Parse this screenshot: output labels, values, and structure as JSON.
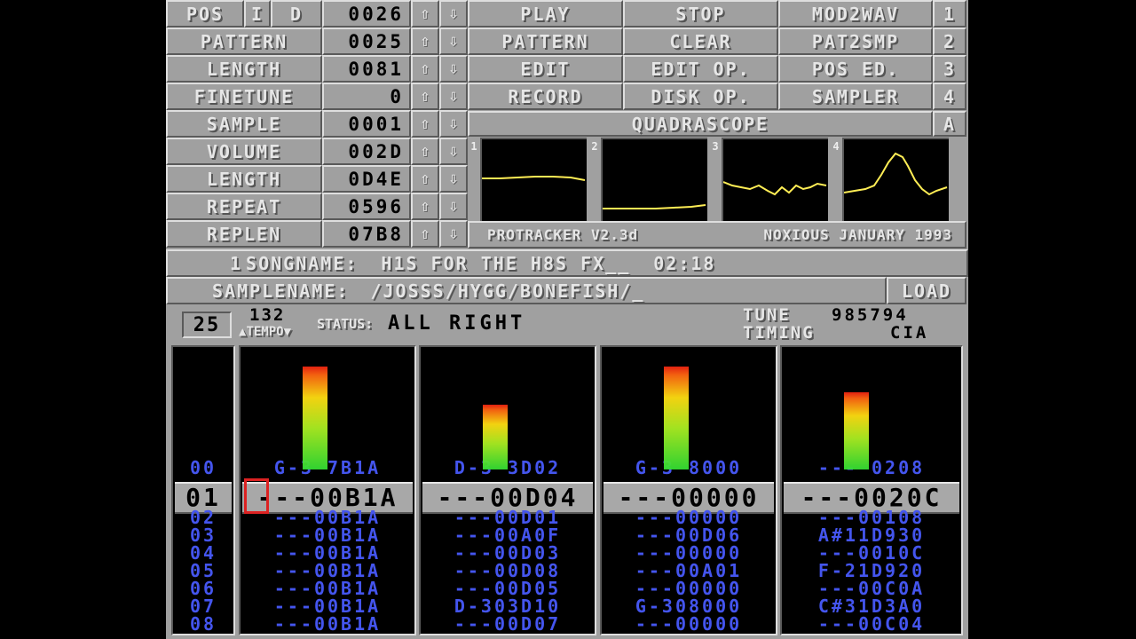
{
  "left_panel": [
    {
      "label": "POS",
      "value": "0026"
    },
    {
      "label": "PATTERN",
      "value": "0025"
    },
    {
      "label": "LENGTH",
      "value": "0081"
    },
    {
      "label": "FINETUNE",
      "value": "0"
    },
    {
      "label": "SAMPLE",
      "value": "0001"
    },
    {
      "label": "VOLUME",
      "value": "002D"
    },
    {
      "label": "LENGTH",
      "value": "0D4E"
    },
    {
      "label": "REPEAT",
      "value": "0596"
    },
    {
      "label": "REPLEN",
      "value": "07B8"
    }
  ],
  "pos_flags": {
    "i": "I",
    "d": "D"
  },
  "arrows": {
    "up": "⇧",
    "down": "⇩"
  },
  "menu_buttons": [
    [
      "PLAY",
      "STOP",
      "MOD2WAV",
      "1"
    ],
    [
      "PATTERN",
      "CLEAR",
      "PAT2SMP",
      "2"
    ],
    [
      "EDIT",
      "EDIT OP.",
      "POS ED.",
      "3"
    ],
    [
      "RECORD",
      "DISK OP.",
      "SAMPLER",
      "4"
    ]
  ],
  "scope": {
    "title": "QUADRASCOPE",
    "mode": "A",
    "channel_tags": [
      "1",
      "2",
      "3",
      "4"
    ],
    "version": "PROTRACKER V2.3d",
    "credit": "NOXIOUS JANUARY 1993",
    "trace_color": "#ffee55"
  },
  "song": {
    "number": "1",
    "label": "SONGNAME:",
    "name": "H1S FOR THE H8S FX__",
    "time": "02:18"
  },
  "sample": {
    "label": "SAMPLENAME:",
    "name": "/JOSSS/HYGG/BONEFISH/_",
    "load_button": "LOAD"
  },
  "status_bar": {
    "pattern_number": "25",
    "tempo": "132",
    "tempo_label": "TEMPO",
    "status_label": "STATUS:",
    "status_value": "ALL RIGHT",
    "tune_label": "TUNE",
    "tune_value": "985794",
    "timing_label": "TIMING",
    "timing_value": "CIA"
  },
  "tracker": {
    "row_numbers": [
      "00",
      "01",
      "02",
      "03",
      "04",
      "05",
      "06",
      "07",
      "08"
    ],
    "cursor_row_index": 1,
    "channels": [
      {
        "rows": [
          "G-3 7B1A",
          "---00B1A",
          "---00B1A",
          "---00B1A",
          "---00B1A",
          "---00B1A",
          "---00B1A",
          "---00B1A",
          "---00B1A"
        ],
        "vu_level": 0.8
      },
      {
        "rows": [
          "D-3 3D02",
          "---00D04",
          "---00D01",
          "---00A0F",
          "---00D03",
          "---00D08",
          "---00D05",
          "D-303D10",
          "---00D07"
        ],
        "vu_level": 0.5
      },
      {
        "rows": [
          "G-3 8000",
          "---00000",
          "---00000",
          "---00D06",
          "---00000",
          "---00A01",
          "---00000",
          "G-308000",
          "---00000"
        ],
        "vu_level": 0.8
      },
      {
        "rows": [
          "--- 0208",
          "---0020C",
          "---00108",
          "A#11D930",
          "---0010C",
          "F-21D920",
          "---00C0A",
          "C#31D3A0",
          "---00C04"
        ],
        "vu_level": 0.6
      }
    ],
    "row_color": "#4455ee",
    "cursor_color": "#dd2222"
  }
}
